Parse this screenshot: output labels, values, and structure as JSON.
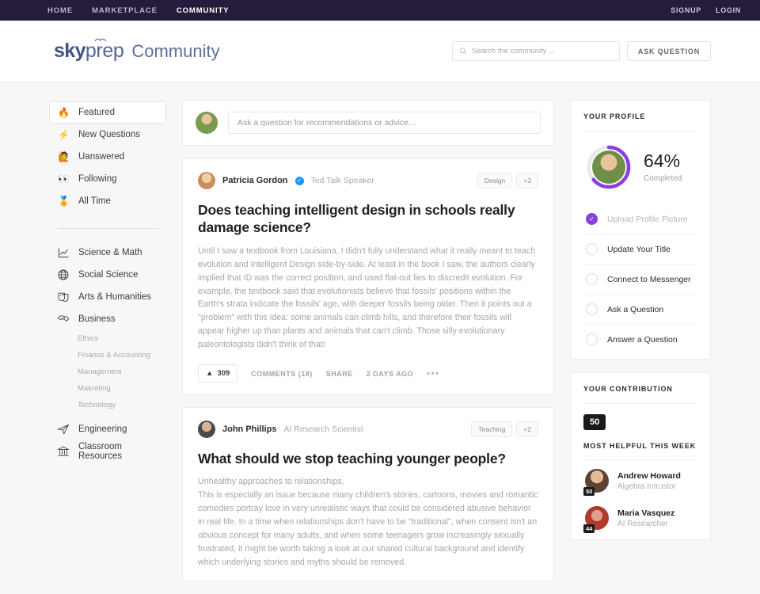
{
  "topbar": {
    "nav": [
      {
        "label": "HOME",
        "active": false
      },
      {
        "label": "MARKETPLACE",
        "active": false
      },
      {
        "label": "COMMUNITY",
        "active": true
      }
    ],
    "signup": "SIGNUP",
    "login": "LOGIN",
    "background": "#261b3a"
  },
  "header": {
    "logo_sky": "sky",
    "logo_prep": "prep",
    "logo_community": "Community",
    "search_placeholder": "Search the community ...",
    "search_value": "",
    "ask_question_label": "ASK QUESTION"
  },
  "sidebar": {
    "filters": [
      {
        "label": "Featured",
        "icon": "fire-icon",
        "emoji": "🔥",
        "active": true
      },
      {
        "label": "New Questions",
        "icon": "lightning-icon",
        "emoji": "⚡",
        "active": false
      },
      {
        "label": "Uanswered",
        "icon": "raising-hand-icon",
        "emoji": "🙋",
        "active": false
      },
      {
        "label": "Following",
        "icon": "eyes-icon",
        "emoji": "👀",
        "active": false
      },
      {
        "label": "All Time",
        "icon": "medal-icon",
        "emoji": "🏅",
        "active": false
      }
    ],
    "categories": [
      {
        "label": "Science & Math",
        "icon": "chart-line-icon"
      },
      {
        "label": "Social Science",
        "icon": "globe-icon"
      },
      {
        "label": "Arts & Humanities",
        "icon": "theater-masks-icon"
      },
      {
        "label": "Business",
        "icon": "handshake-icon",
        "children": [
          "Ethics",
          "Finance & Accounting",
          "Management",
          "Makreting",
          "Technology"
        ]
      },
      {
        "label": "Engineering",
        "icon": "paper-plane-icon"
      },
      {
        "label": "Classroom Resources",
        "icon": "bank-icon"
      }
    ]
  },
  "ask_box": {
    "placeholder": "Ask a question for recommendations or advice...",
    "value": ""
  },
  "posts": [
    {
      "author": "Patricia Gordon",
      "verified": true,
      "role": "Ted Talk Speaker",
      "tags": [
        "Design",
        "+3"
      ],
      "title": "Does teaching intelligent design in schools really damage science?",
      "body": "Until I saw a textbook from Louisiana, I didn't fully understand what it really meant to teach evolution and Intelligent Design side-by-side. At least in the book I saw, the authors clearly implied that ID was the correct position, and used flat-out lies to discredit evolution. For example, the textbook said that evolutionists believe that fossils' positions within the Earth's strata indicate the fossils' age, with deeper fossils being older. Then it points out a \"problem\" with this idea: some animals can climb hills, and therefore their fossils will appear higher up than plants and animals that can't climb. Those silly evolutionary paleontologists didn't think of that!",
      "votes": "309",
      "vote_arrow": "▲",
      "comments_label": "COMMENTS (18)",
      "share_label": "SHARE",
      "time_label": "2 DAYS AGO",
      "more_label": "•••"
    },
    {
      "author": "John Phillips",
      "verified": false,
      "role": "AI Research Scientist",
      "tags": [
        "Teaching",
        "+2"
      ],
      "title": "What should we stop teaching younger people?",
      "body": "Unhealthy approaches to relationships.\nThis is especially an issue because many children's stories, cartoons, movies and romantic comedies portray love in very unrealistic ways that could be considered abusive behavior in real life. In a time when relationships don't have to be \"traditional\", when consent isn't an obvious concept for many adults, and when some teenagers grow increasingly sexually frustrated, it might be worth taking a look at our shared cultural background and identify which underlying stories and myths should be removed."
    }
  ],
  "profile_card": {
    "title": "YOUR PROFILE",
    "percent": "64%",
    "percent_value": 64,
    "completed_label": "Completed",
    "accent": "#8b3fe0",
    "track": "#e8e8e8",
    "checklist": [
      {
        "label": "Upload Profile Picture",
        "done": true,
        "check": "✓"
      },
      {
        "label": "Update Your Title",
        "done": false
      },
      {
        "label": "Connect to Messenger",
        "done": false
      },
      {
        "label": "Ask a Question",
        "done": false
      },
      {
        "label": "Answer a Question",
        "done": false
      }
    ]
  },
  "contribution_card": {
    "title": "YOUR CONTRIBUTION",
    "score": "50",
    "most_helpful_title": "MOST HELPFUL THIS WEEK",
    "helpers": [
      {
        "name": "Andrew Howard",
        "role": "Algebra Intrustor",
        "score": "50"
      },
      {
        "name": "Maria Vasquez",
        "role": "AI Researcher",
        "score": "44"
      }
    ]
  }
}
